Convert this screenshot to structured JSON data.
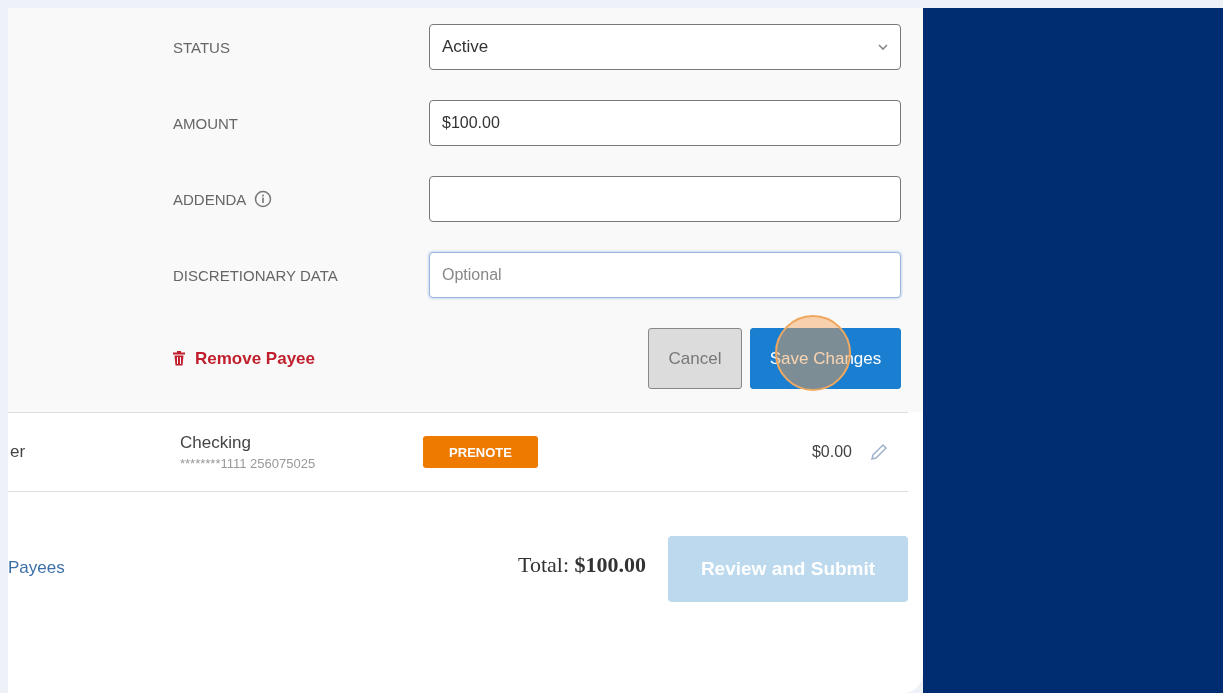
{
  "form": {
    "fields": [
      {
        "label": "STATUS",
        "kind": "select",
        "value": "Active",
        "info": false,
        "focused": false
      },
      {
        "label": "AMOUNT",
        "kind": "text",
        "value": "$100.00",
        "info": false,
        "focused": false
      },
      {
        "label": "ADDENDA",
        "kind": "text",
        "info": true,
        "focused": false
      },
      {
        "label": "DISCRETIONARY DATA",
        "kind": "text",
        "placeholder": "Optional",
        "info": false,
        "focused": true
      }
    ],
    "remove_link": "Remove Payee",
    "buttons": [
      {
        "label": "Cancel",
        "kind": "secondary"
      },
      {
        "label": "Save Changes",
        "kind": "primary"
      }
    ]
  },
  "payee_row": {
    "name": "er",
    "account_type": "Checking",
    "account_number": "********1111 256075025",
    "badge": "PRENOTE",
    "amount": "$0.00"
  },
  "footer": {
    "link": "Payees",
    "total_label": "Total:",
    "total_value": "$100.00",
    "submit": {
      "label": "Review and Submit",
      "disabled": true
    }
  }
}
